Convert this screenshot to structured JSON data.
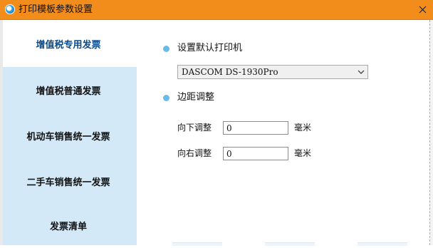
{
  "window": {
    "title": "打印模板参数设置",
    "close_glyph": "✕",
    "accent_color": "#f28c1a",
    "sidebar_color": "#d4e9f7"
  },
  "sidebar": {
    "items": [
      {
        "label": "增值税专用发票",
        "active": true
      },
      {
        "label": "增值税普通发票",
        "active": false
      },
      {
        "label": "机动车销售统一发票",
        "active": false
      },
      {
        "label": "二手车销售统一发票",
        "active": false
      },
      {
        "label": "发票清单",
        "active": false
      }
    ]
  },
  "printer": {
    "section_label": "设置默认打印机",
    "selected": "DASCOM DS-1930Pro"
  },
  "margins": {
    "section_label": "边距调整",
    "down": {
      "label": "向下调整",
      "value": "0",
      "unit": "毫米"
    },
    "right": {
      "label": "向右调整",
      "value": "0",
      "unit": "毫米"
    }
  }
}
